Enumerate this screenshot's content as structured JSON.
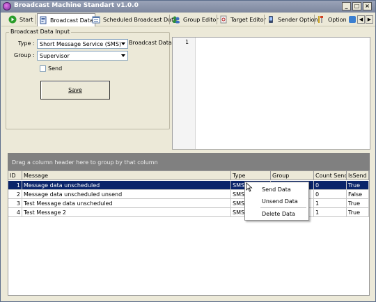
{
  "window": {
    "title": "Broadcast Machine Standart v1.0.0"
  },
  "window_buttons": {
    "minimize": "_",
    "maximize": "□",
    "close": "×"
  },
  "toolbar": {
    "items": [
      {
        "label": "Start",
        "icon": "play-icon"
      },
      {
        "label": "Broadcast Data",
        "icon": "document-icon"
      },
      {
        "label": "Scheduled Broadcast Data",
        "icon": "calendar-list-icon"
      },
      {
        "label": "Group Editor",
        "icon": "group-icon"
      },
      {
        "label": "Target Editor",
        "icon": "target-icon"
      },
      {
        "label": "Sender Option",
        "icon": "phone-icon"
      },
      {
        "label": "Option",
        "icon": "tools-icon"
      }
    ],
    "active_index": 1,
    "scroll_left": "◀",
    "scroll_right": "▶"
  },
  "form": {
    "legend": "Broadcast Data Input",
    "type_label": "Type :",
    "type_value": "Short Message Service (SMS)",
    "group_label": "Group :",
    "group_value": "Supervisor",
    "send_label": "Send",
    "send_checked": false,
    "save_label": "Save",
    "broadcast_data_label": "Broadcast Data :",
    "editor_line": "1"
  },
  "group_bar": {
    "text": "Drag a column header here to group by that column"
  },
  "grid": {
    "columns": [
      "ID",
      "Message",
      "Type",
      "Group",
      "Count Send",
      "IsSend"
    ],
    "rows": [
      {
        "id": "1",
        "message": "Message data unscheduled",
        "type": "SMS",
        "group": "",
        "count_send": "0",
        "is_send": "True",
        "selected": true
      },
      {
        "id": "2",
        "message": "Message data unscheduled unsend",
        "type": "SMS",
        "group": "",
        "count_send": "0",
        "is_send": "False",
        "selected": false
      },
      {
        "id": "3",
        "message": "Test Message data unscheduled",
        "type": "SMS",
        "group": "",
        "count_send": "1",
        "is_send": "True",
        "selected": false
      },
      {
        "id": "4",
        "message": "Test Message 2",
        "type": "SMS",
        "group": "",
        "count_send": "1",
        "is_send": "True",
        "selected": false
      }
    ]
  },
  "context_menu": {
    "items": [
      "Send Data",
      "Unsend Data",
      "Delete Data"
    ]
  },
  "colors": {
    "selection": "#0a246a",
    "group_bar": "#808080",
    "window_bg": "#ece9d8"
  }
}
